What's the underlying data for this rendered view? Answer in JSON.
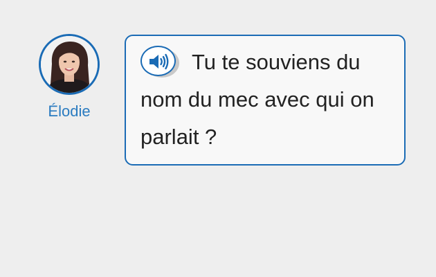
{
  "speaker": {
    "name": "Élodie",
    "avatar_icon": "woman-portrait-avatar"
  },
  "bubble": {
    "audio_icon": "speaker-volume-icon",
    "text": "Tu te souviens du nom du mec avec qui on parlait ?"
  },
  "colors": {
    "accent": "#1a6bb5",
    "name_text": "#2a7bc0",
    "background": "#eeeeee",
    "bubble_background": "#f8f8f8"
  }
}
